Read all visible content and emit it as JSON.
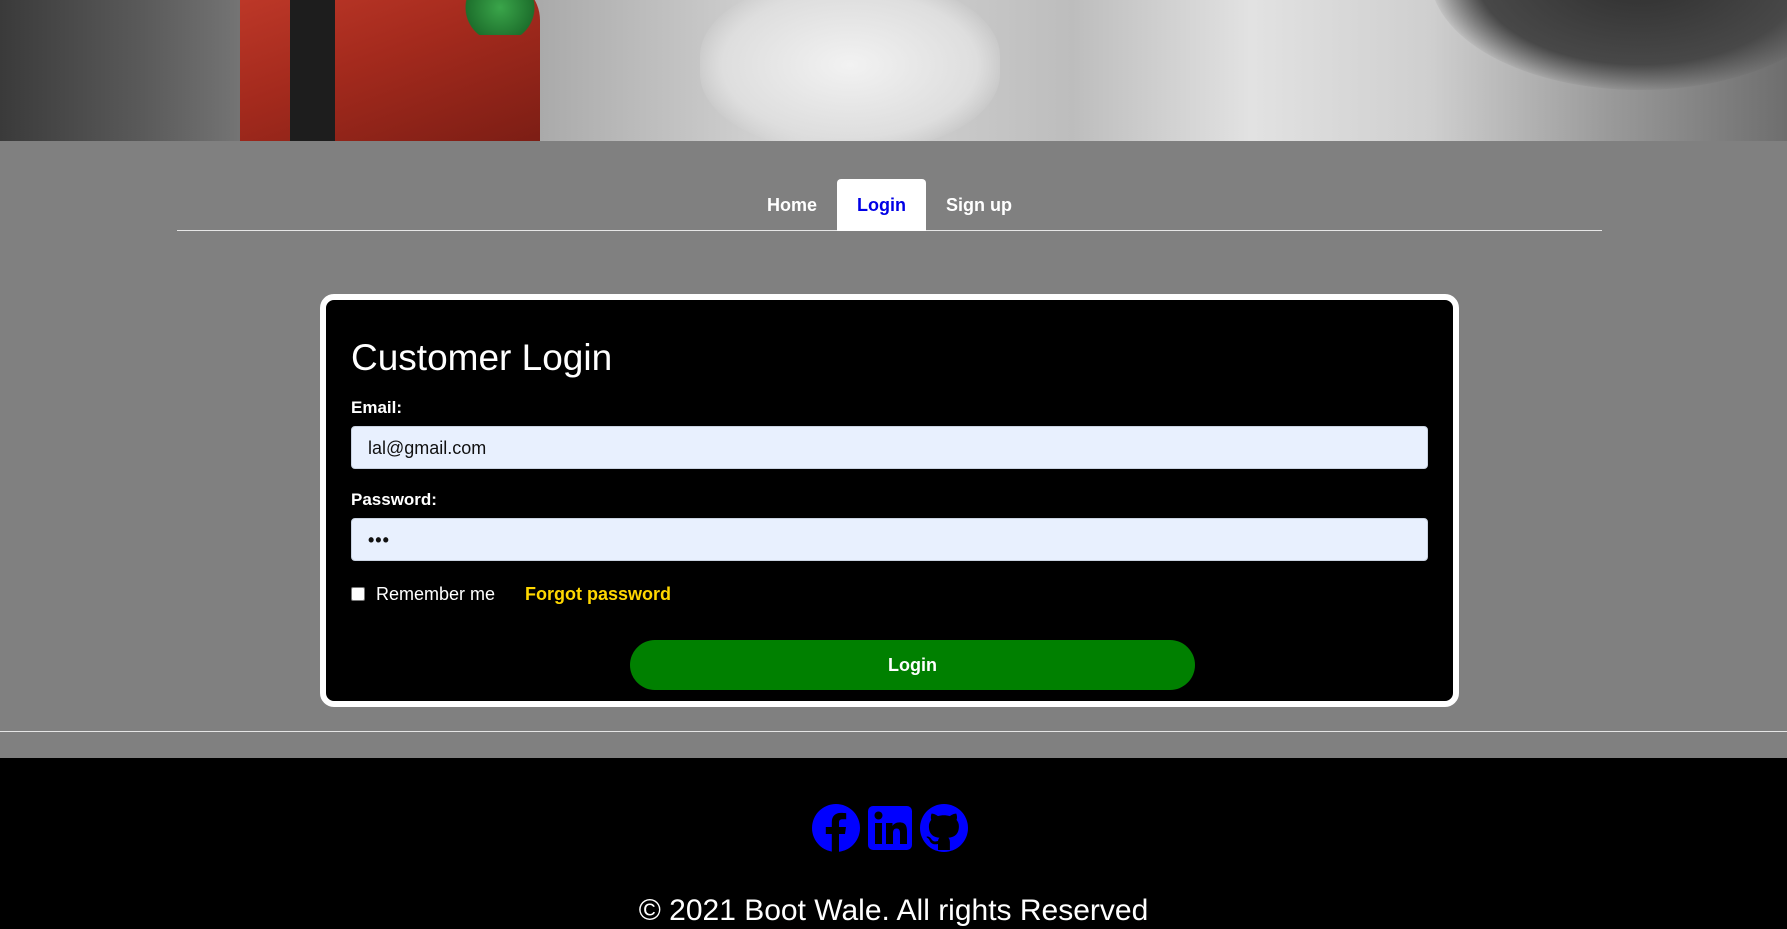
{
  "nav": {
    "tabs": [
      {
        "label": "Home",
        "active": false
      },
      {
        "label": "Login",
        "active": true
      },
      {
        "label": "Sign up",
        "active": false
      }
    ]
  },
  "login": {
    "title": "Customer Login",
    "email_label": "Email:",
    "email_value": "lal@gmail.com",
    "password_label": "Password:",
    "password_masked": "•••",
    "remember_label": "Remember me",
    "remember_checked": false,
    "forgot_label": "Forgot password",
    "submit_label": "Login"
  },
  "footer": {
    "social_icons": [
      "facebook-icon",
      "linkedin-icon",
      "github-icon"
    ],
    "copyright": "© 2021 Boot Wale. All rights Reserved"
  },
  "colors": {
    "background": "#808080",
    "card": "#000000",
    "active_tab_text": "#0000e6",
    "link_yellow": "#ffd700",
    "button_green": "#008000",
    "social_blue": "#0000ff"
  }
}
